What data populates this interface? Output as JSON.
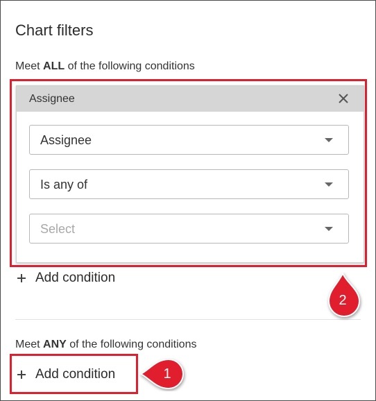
{
  "panel": {
    "title": "Chart filters"
  },
  "all_group": {
    "prefix": "Meet ",
    "keyword": "ALL",
    "suffix": " of the following conditions",
    "condition_card": {
      "header_title": "Assignee",
      "close_icon": "close-icon",
      "field_select": {
        "value": "Assignee"
      },
      "operator_select": {
        "value": "Is any of"
      },
      "value_select": {
        "placeholder": "Select"
      }
    },
    "add_condition_label": "Add condition"
  },
  "any_group": {
    "prefix": "Meet ",
    "keyword": "ANY",
    "suffix": " of the following conditions",
    "add_condition_label": "Add condition"
  },
  "annotations": {
    "callout_1": "1",
    "callout_2": "2",
    "highlight_color": "#e01e2d"
  }
}
